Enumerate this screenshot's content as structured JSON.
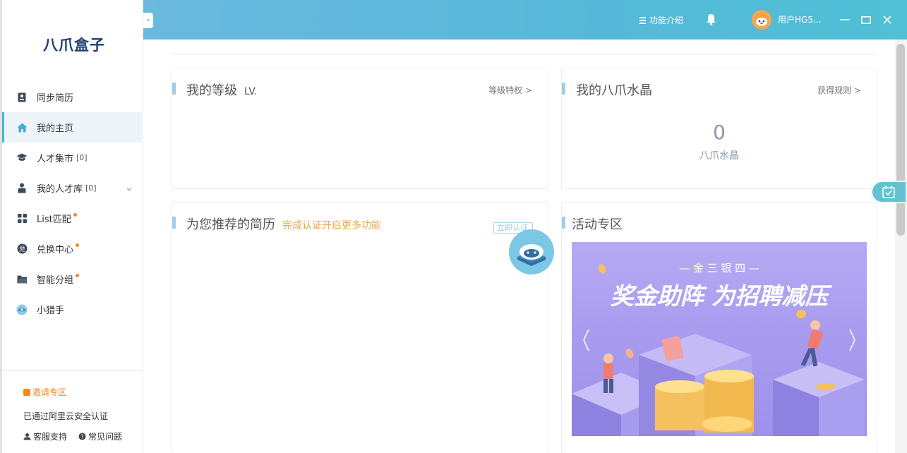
{
  "app": {
    "logo_text": "八爪盒子"
  },
  "header": {
    "func_intro": "功能介绍",
    "username": "用户HG5..."
  },
  "sidebar": {
    "items": [
      {
        "label": "同步简历",
        "icon": "resume-icon"
      },
      {
        "label": "我的主页",
        "icon": "home-icon",
        "active": true
      },
      {
        "label": "人才集市",
        "count": "[0]",
        "icon": "graduation-cap-icon"
      },
      {
        "label": "我的人才库",
        "count": "[0]",
        "icon": "person-icon",
        "expandable": true
      },
      {
        "label": "List匹配",
        "icon": "grid-icon",
        "dot": true
      },
      {
        "label": "兑换中心",
        "icon": "exchange-icon",
        "dot": true
      },
      {
        "label": "智能分组",
        "icon": "folder-icon",
        "dot": true
      },
      {
        "label": "小猎手",
        "icon": "hunter-icon"
      }
    ],
    "invite": "邀请专区",
    "auth_text": "已通过阿里云安全认证",
    "support": "客服支持",
    "faq": "常见问题"
  },
  "level_card": {
    "title": "我的等级",
    "level_prefix": "LV.",
    "link": "等级特权 >"
  },
  "crystal_card": {
    "title": "我的八爪水晶",
    "link": "获得规则 >",
    "value": "0",
    "unit_label": "八爪水晶"
  },
  "resume_card": {
    "title": "为您推荐的简历",
    "note": "完成认证开启更多功能",
    "btn": "立即认证"
  },
  "activity_card": {
    "title": "活动专区",
    "banner_subtitle": "— 金 三 银 四 —",
    "banner_title": "奖金助阵 为招聘减压"
  },
  "colors": {
    "header_gradient_start": "#6ab9df",
    "accent": "#4bb3d6",
    "orange": "#f08a1c",
    "logo": "#1d3f76"
  }
}
